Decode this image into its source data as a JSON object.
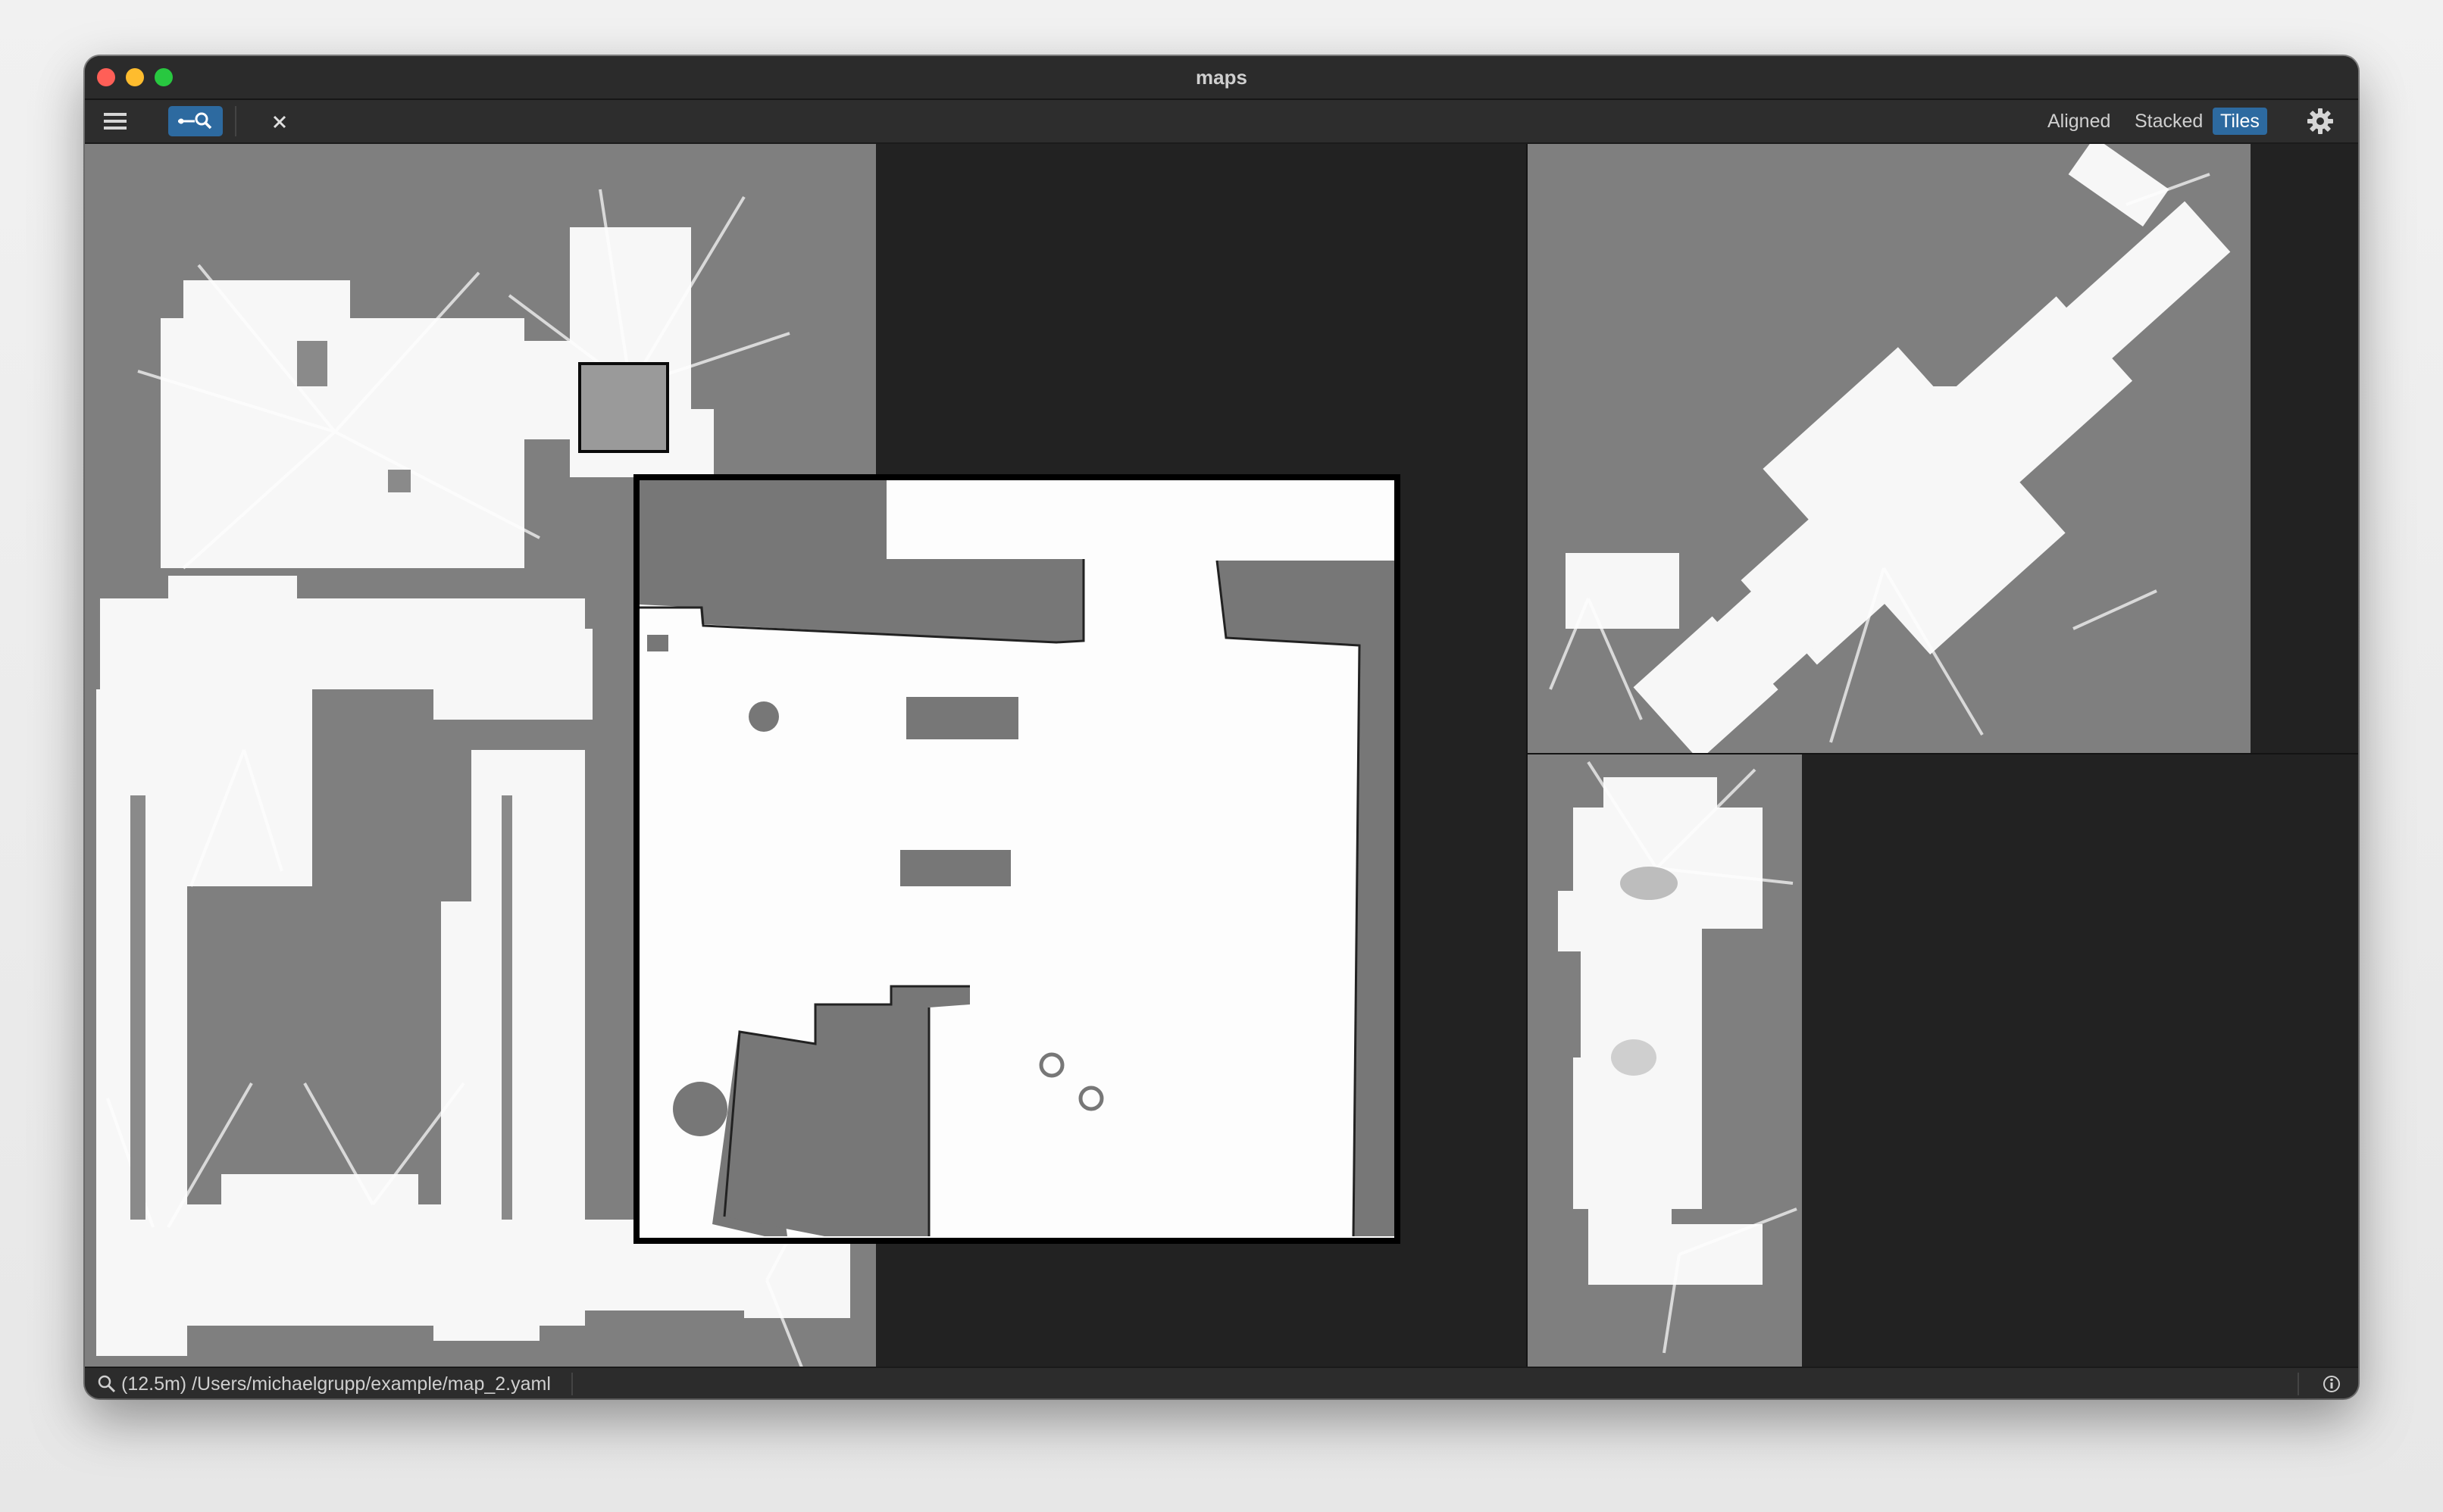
{
  "window": {
    "title": "maps",
    "traffic_lights": {
      "close": "#ff5f57",
      "minimize": "#febc2e",
      "zoom": "#28c840"
    }
  },
  "toolbar": {
    "menu_icon": "hamburger-menu-icon",
    "lens_toggle_icon": "link-magnifier-icon",
    "close_icon": "close-icon",
    "view_modes": [
      {
        "label": "Aligned",
        "active": false
      },
      {
        "label": "Stacked",
        "active": false
      },
      {
        "label": "Tiles",
        "active": true
      }
    ],
    "settings_icon": "gear-icon",
    "accent": "#2d6aa0"
  },
  "tiles": [
    {
      "name": "map-tile-1",
      "kind": "occupancy-grid"
    },
    {
      "name": "map-tile-2",
      "kind": "occupancy-grid"
    },
    {
      "name": "map-tile-3",
      "kind": "occupancy-grid"
    }
  ],
  "magnifier": {
    "kind": "zoomed-inset"
  },
  "status": {
    "icon": "magnifier-icon",
    "text": "(12.5m) /Users/michaelgrupp/example/map_2.yaml",
    "info_icon": "info-icon"
  }
}
